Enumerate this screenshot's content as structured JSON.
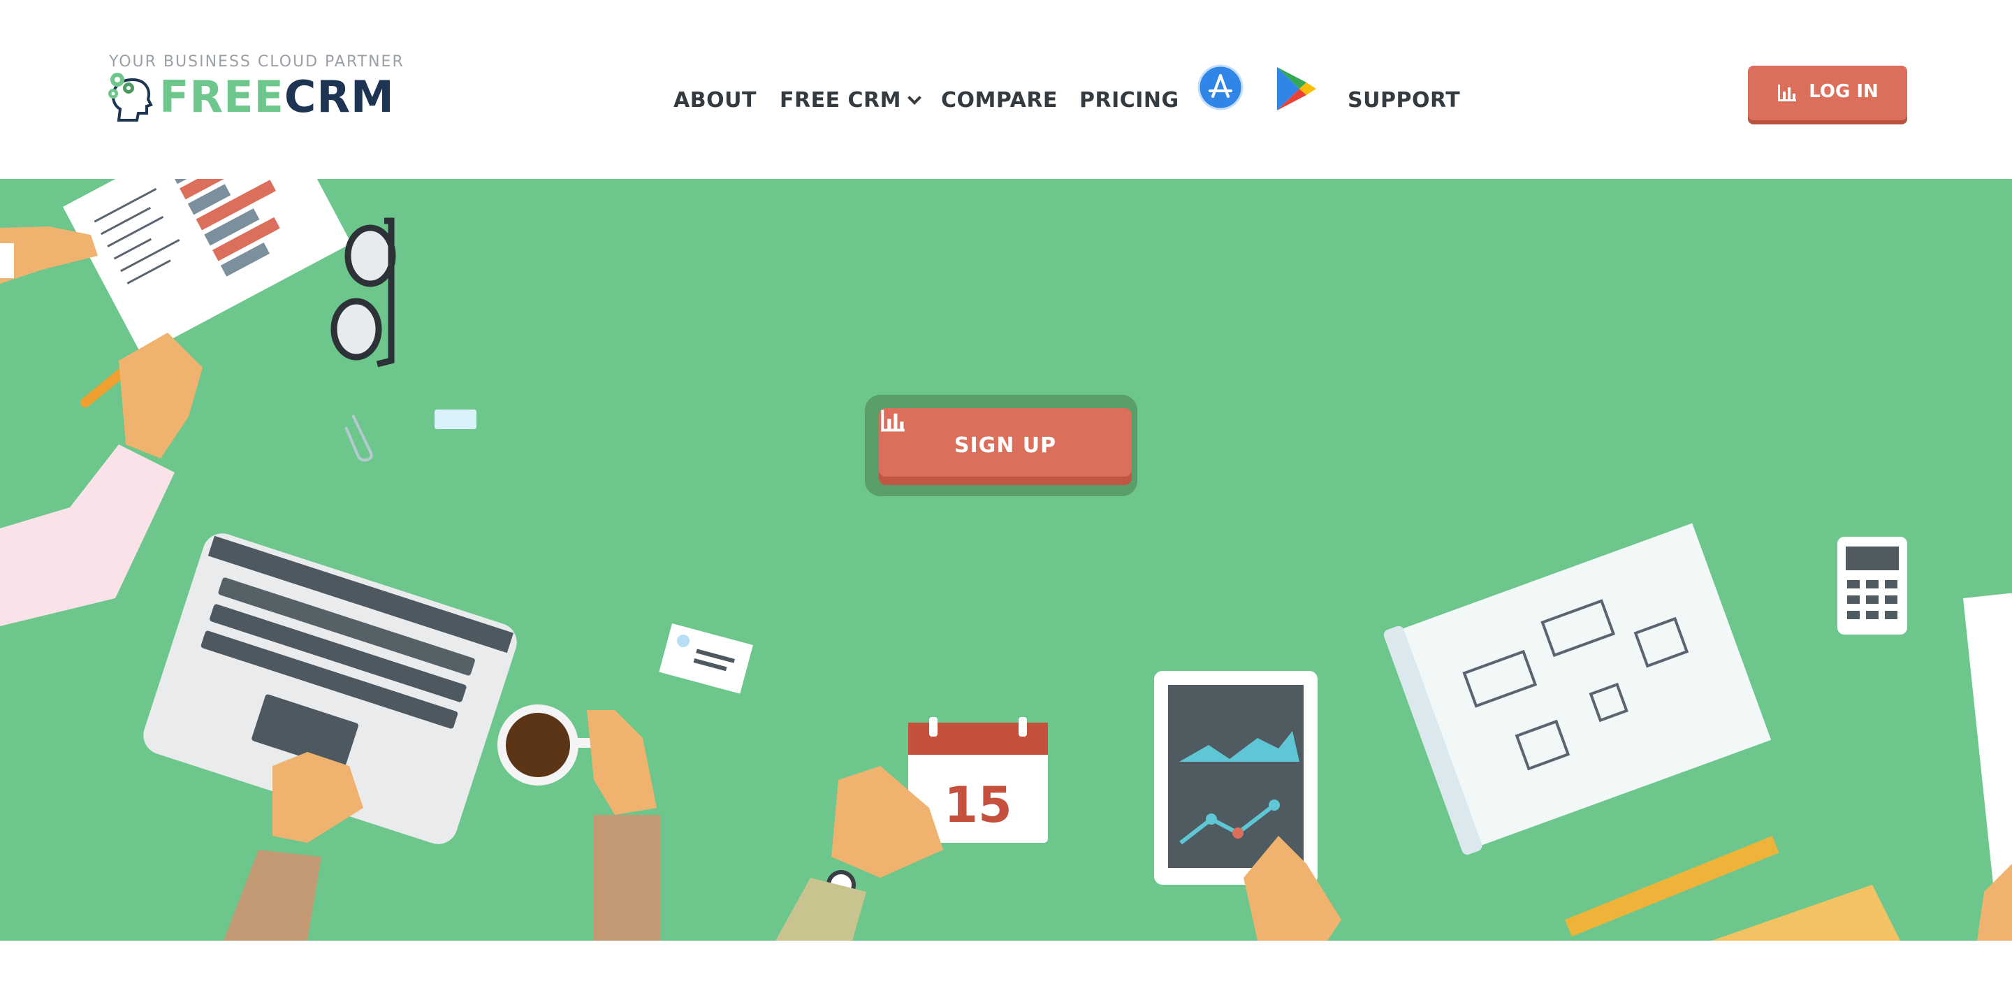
{
  "header": {
    "tagline": "YOUR BUSINESS CLOUD PARTNER",
    "logo": {
      "part1": "FREE",
      "part2": "CRM",
      "icon": "head-gears-icon"
    },
    "nav": [
      {
        "label": "ABOUT"
      },
      {
        "label": "FREE CRM",
        "has_dropdown": true
      },
      {
        "label": "COMPARE"
      },
      {
        "label": "PRICING"
      },
      {
        "label": "SUPPORT"
      }
    ],
    "store_icons": [
      "app-store-icon",
      "google-play-icon"
    ],
    "login_label": "LOG IN"
  },
  "hero": {
    "signup_label": "SIGN UP",
    "calendar_day": "15",
    "button_icon": "bar-chart-icon"
  },
  "colors": {
    "brand_green": "#6dc68c",
    "brand_navy": "#1d3553",
    "accent_red": "#dc6f5c",
    "nav_text": "#333a40"
  }
}
